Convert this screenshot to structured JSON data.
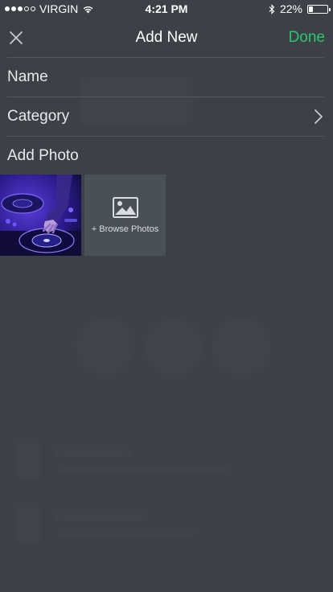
{
  "status_bar": {
    "carrier": "VIRGIN",
    "time": "4:21 PM",
    "battery_percent": "22%",
    "battery_level": 0.22,
    "signal_bars_filled": 3,
    "signal_bars_total": 5
  },
  "nav": {
    "close_icon": "close-icon",
    "title": "Add New",
    "done_label": "Done"
  },
  "form": {
    "name_label": "Name",
    "category_label": "Category",
    "add_photo_label": "Add Photo"
  },
  "photos": {
    "browse_label": "+ Browse Photos"
  },
  "colors": {
    "accent": "#2fc56f",
    "background": "#3c4147",
    "divider": "#52585e",
    "tile": "#4a5057"
  }
}
